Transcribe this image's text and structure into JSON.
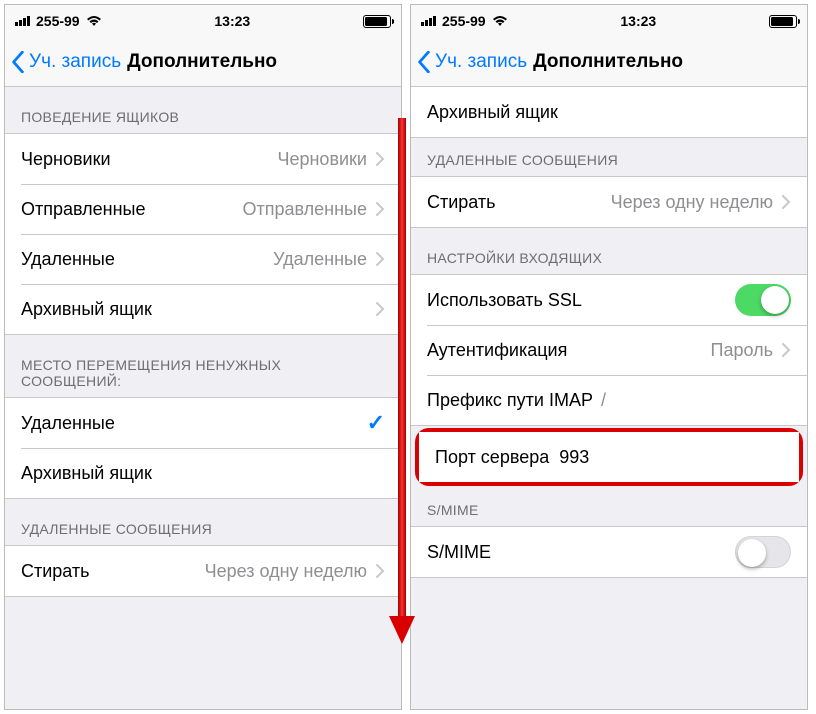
{
  "statusbar": {
    "carrier": "255-99",
    "time": "13:23"
  },
  "nav": {
    "back": "Уч. запись",
    "title": "Дополнительно"
  },
  "left": {
    "section_mailbox_behavior": "ПОВЕДЕНИЕ ЯЩИКОВ",
    "drafts_label": "Черновики",
    "drafts_value": "Черновики",
    "sent_label": "Отправленные",
    "sent_value": "Отправленные",
    "deleted_label": "Удаленные",
    "deleted_value": "Удаленные",
    "archive_label": "Архивный ящик",
    "section_move_discarded": "МЕСТО ПЕРЕМЕЩЕНИЯ НЕНУЖНЫХ СООБЩЕНИЙ:",
    "move_deleted": "Удаленные",
    "move_archive": "Архивный ящик",
    "section_deleted_messages": "УДАЛЕННЫЕ СООБЩЕНИЯ",
    "remove_label": "Стирать",
    "remove_value": "Через одну неделю"
  },
  "right": {
    "archive_label": "Архивный ящик",
    "section_deleted_messages": "УДАЛЕННЫЕ СООБЩЕНИЯ",
    "remove_label": "Стирать",
    "remove_value": "Через одну неделю",
    "section_incoming": "НАСТРОЙКИ ВХОДЯЩИХ",
    "ssl_label": "Использовать SSL",
    "auth_label": "Аутентификация",
    "auth_value": "Пароль",
    "imap_prefix_label": "Префикс пути IMAP",
    "imap_prefix_value": "/",
    "port_label": "Порт сервера",
    "port_value": "993",
    "section_smime": "S/MIME",
    "smime_label": "S/MIME"
  }
}
